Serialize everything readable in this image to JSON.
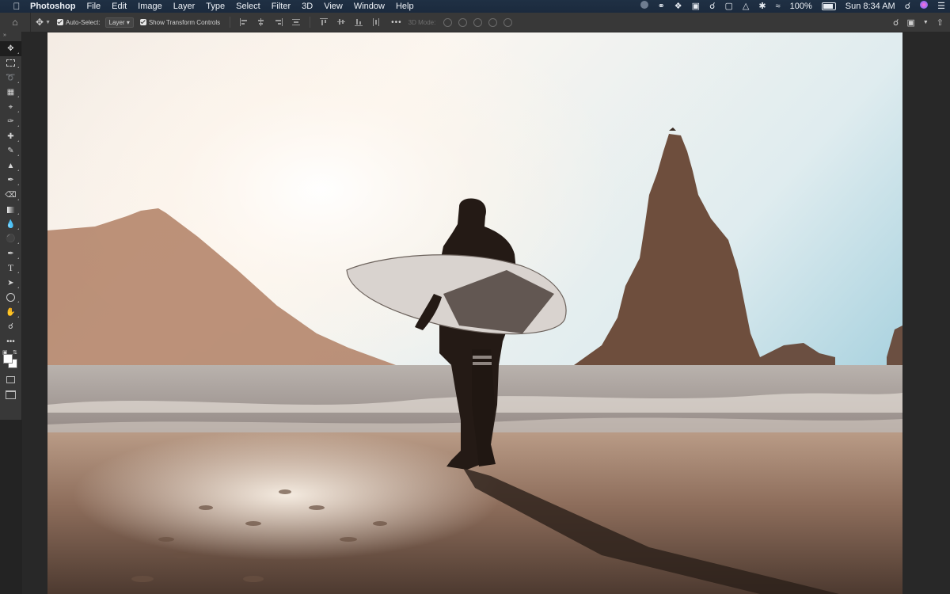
{
  "menubar": {
    "app_name": "Photoshop",
    "menus": [
      "File",
      "Edit",
      "Image",
      "Layer",
      "Type",
      "Select",
      "Filter",
      "3D",
      "View",
      "Window",
      "Help"
    ],
    "battery_percent": "100%",
    "clock": "Sun 8:34 AM"
  },
  "options": {
    "auto_select_label": "Auto-Select:",
    "auto_select_value": "Layer",
    "transform_label": "Show Transform Controls",
    "mode_label": "3D Mode:"
  },
  "toolbar": {
    "tools": [
      "move",
      "marquee",
      "lasso",
      "object-select",
      "crop",
      "eyedropper",
      "healing",
      "brush",
      "stamp",
      "history-brush",
      "eraser",
      "gradient",
      "blur",
      "dodge",
      "pen",
      "type",
      "path-select",
      "shape",
      "hand",
      "zoom",
      "more"
    ]
  },
  "colors": {
    "menubar_bg": "#1c2b3e",
    "panel_bg": "#383838",
    "workspace_bg": "#282828"
  }
}
